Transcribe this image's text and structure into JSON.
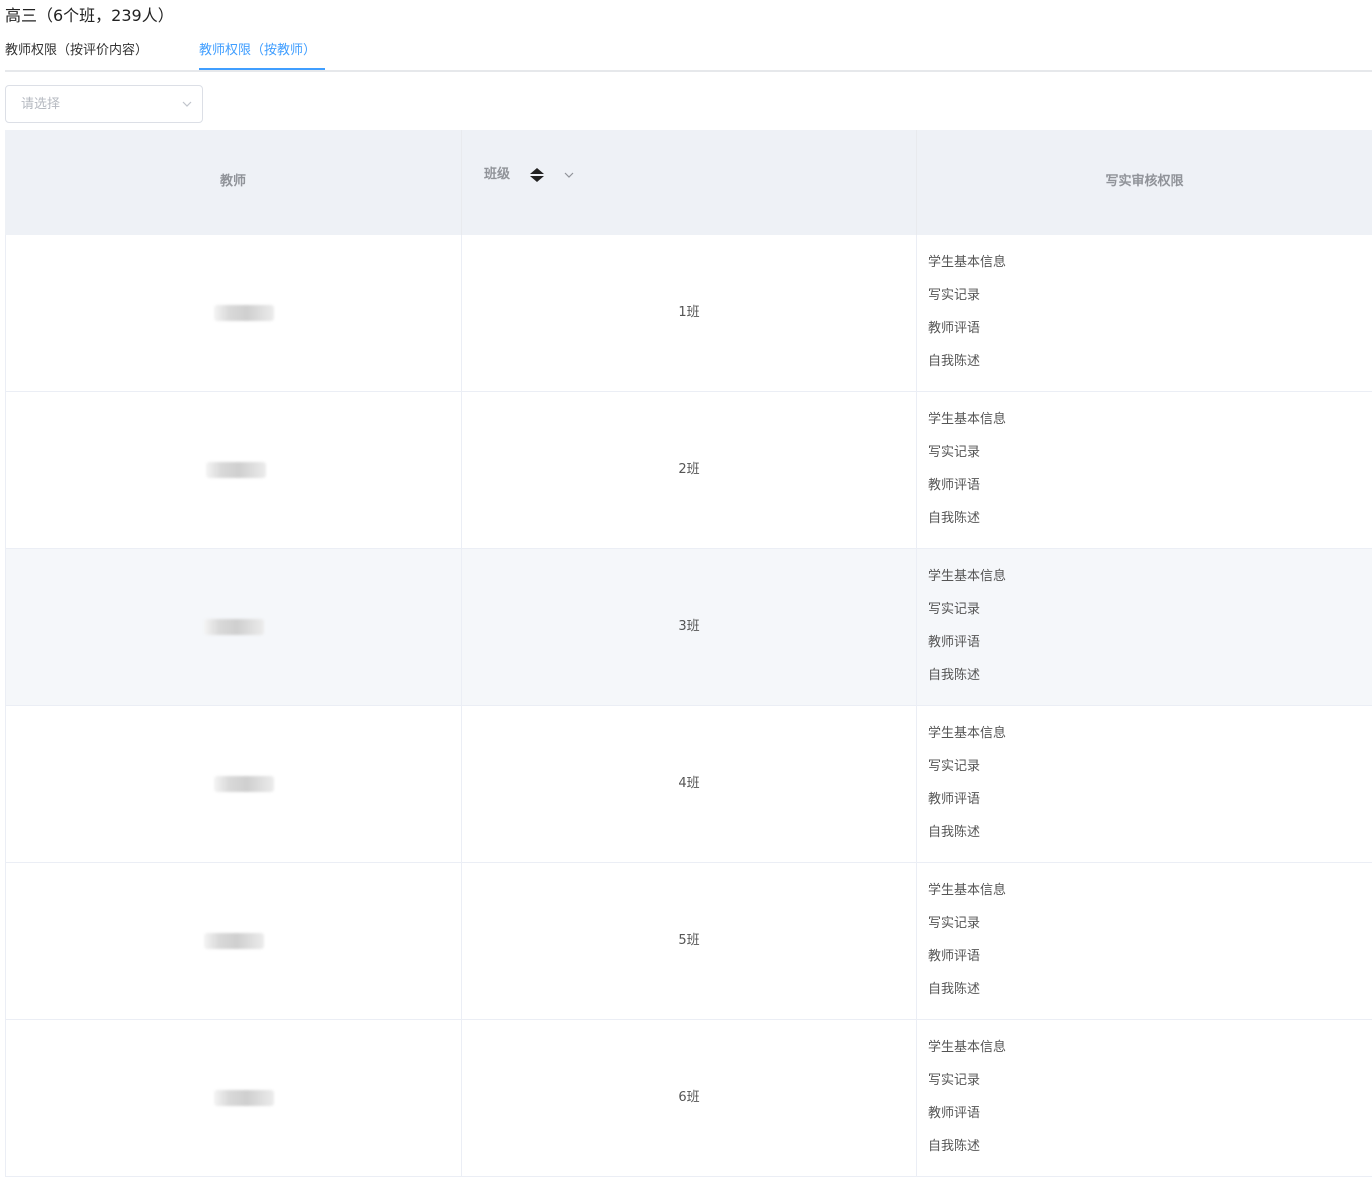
{
  "header": {
    "title": "高三（6个班，239人）"
  },
  "tabs": [
    {
      "label": "教师权限（按评价内容）",
      "active": false
    },
    {
      "label": "教师权限（按教师）",
      "active": true
    }
  ],
  "filter": {
    "placeholder": "请选择"
  },
  "table": {
    "columns": {
      "teacher": "教师",
      "class": "班级",
      "permissions": "写实审核权限"
    },
    "rows": [
      {
        "teacher": "",
        "class": "1班",
        "permissions": [
          "学生基本信息",
          "写实记录",
          "教师评语",
          "自我陈述"
        ]
      },
      {
        "teacher": "",
        "class": "2班",
        "permissions": [
          "学生基本信息",
          "写实记录",
          "教师评语",
          "自我陈述"
        ]
      },
      {
        "teacher": "",
        "class": "3班",
        "permissions": [
          "学生基本信息",
          "写实记录",
          "教师评语",
          "自我陈述"
        ]
      },
      {
        "teacher": "",
        "class": "4班",
        "permissions": [
          "学生基本信息",
          "写实记录",
          "教师评语",
          "自我陈述"
        ]
      },
      {
        "teacher": "",
        "class": "5班",
        "permissions": [
          "学生基本信息",
          "写实记录",
          "教师评语",
          "自我陈述"
        ]
      },
      {
        "teacher": "",
        "class": "6班",
        "permissions": [
          "学生基本信息",
          "写实记录",
          "教师评语",
          "自我陈述"
        ]
      }
    ]
  },
  "colors": {
    "accent": "#409eff",
    "header_bg": "#eef1f6",
    "hover_row_bg": "#f5f7fa",
    "border": "#ebeef5"
  },
  "icons": {
    "select_arrow": "chevron-down-icon",
    "sort": "sort-icon",
    "filter": "filter-chevron-icon"
  }
}
